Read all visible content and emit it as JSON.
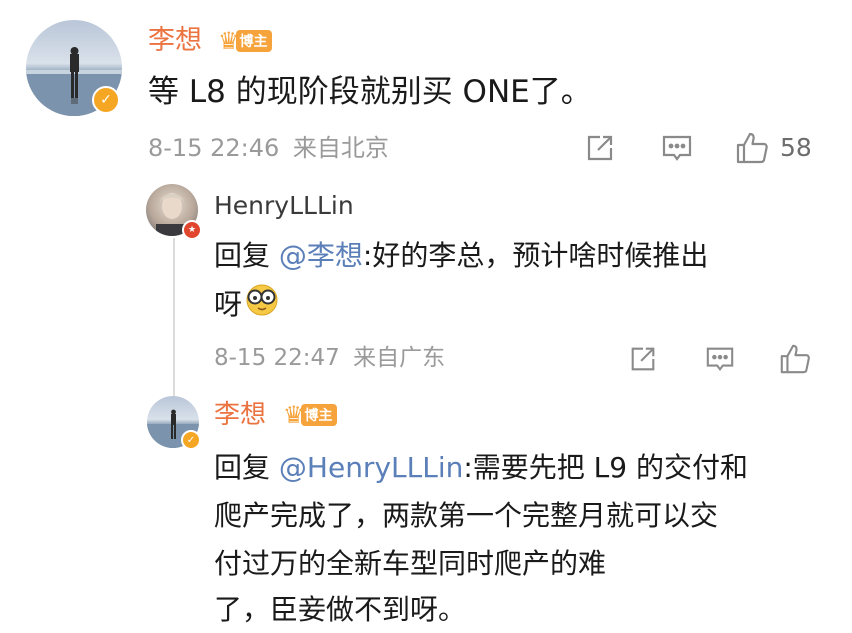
{
  "comment": {
    "author": "李想",
    "badge": "博主",
    "text": "等 L8 的现阶段就别买 ONE了。",
    "time": "8-15 22:46",
    "source": "来自北京",
    "likes": "58"
  },
  "reply1": {
    "author": "HenryLLLin",
    "prefix": "回复 ",
    "mention": "@李想",
    "text_line1": ":好的李总，预计啥时候推出",
    "text_line2": "呀",
    "time": "8-15 22:47",
    "source": "来自广东"
  },
  "reply2": {
    "author": "李想",
    "badge": "博主",
    "prefix": "回复 ",
    "mention": "@HenryLLLin",
    "text_line1": ":需要先把 L9 的交付和",
    "text_line2": "爬产完成了，两款第一个完整月就可以交",
    "text_line3": "付过万的全新车型同时爬产的难",
    "text_line4": "了，臣妾做不到呀。"
  },
  "colors": {
    "author_vip": "#eb7340",
    "mention": "#5b7fb8",
    "meta": "#9a9a9a",
    "badge": "#f7a33b"
  }
}
